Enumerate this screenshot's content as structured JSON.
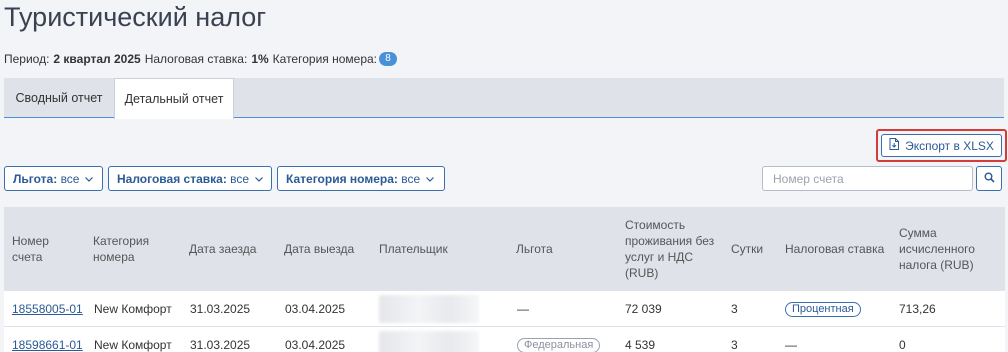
{
  "page": {
    "title": "Туристический налог"
  },
  "info": {
    "period_label": "Период:",
    "period_value": "2 квартал 2025",
    "rate_label": "Налоговая ставка:",
    "rate_value": "1%",
    "category_label": "Категория номера:",
    "category_count": "8"
  },
  "tabs": [
    {
      "label": "Сводный отчет",
      "active": false
    },
    {
      "label": "Детальный отчет",
      "active": true
    }
  ],
  "toolbar": {
    "export_label": "Экспорт в XLSX"
  },
  "filters": [
    {
      "label": "Льгота:",
      "value": "все"
    },
    {
      "label": "Налоговая ставка:",
      "value": "все"
    },
    {
      "label": "Категория номера:",
      "value": "все"
    }
  ],
  "search": {
    "placeholder": "Номер счета"
  },
  "table": {
    "headers": [
      "Номер счета",
      "Категория номера",
      "Дата заезда",
      "Дата выезда",
      "Плательщик",
      "Льгота",
      "Стоимость проживания без услуг и НДС (RUB)",
      "Сутки",
      "Налоговая ставка",
      "Сумма исчисленного налога (RUB)"
    ],
    "rows": [
      {
        "account": "18558005-01",
        "category": "New Комфорт",
        "checkin": "31.03.2025",
        "checkout": "03.04.2025",
        "benefit": "—",
        "cost": "72 039",
        "days": "3",
        "rate": "Процентная",
        "tax": "713,26"
      },
      {
        "account": "18598661-01",
        "category": "New Комфорт",
        "checkin": "31.03.2025",
        "checkout": "03.04.2025",
        "benefit": "Федеральная",
        "cost": "4 539",
        "days": "3",
        "rate": "—",
        "tax": "0"
      }
    ]
  },
  "colors": {
    "accent": "#2b5a95",
    "highlight_border": "#d43b3b",
    "header_bg": "#dfe3e9",
    "page_bg": "#f2f4f7"
  }
}
